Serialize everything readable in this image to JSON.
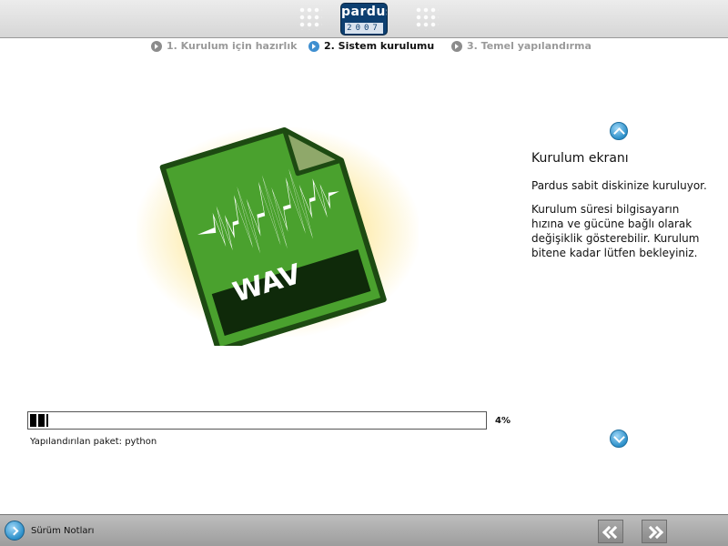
{
  "header": {
    "logo_text": "pardus",
    "logo_year": "2007"
  },
  "steps": [
    {
      "label": "1. Kurulum için hazırlık",
      "state": "done"
    },
    {
      "label": "2. Sistem kurulumu",
      "state": "active"
    },
    {
      "label": "3. Temel yapılandırma",
      "state": "pending"
    }
  ],
  "illustration": {
    "icon": "wav-file-icon",
    "label": "WAV",
    "colors": {
      "file": "#4aa12e",
      "border": "#1d4a12",
      "band": "#0f2a0a",
      "glow": "#fad65a"
    }
  },
  "panel": {
    "title": "Kurulum ekranı",
    "paragraph_1": "Pardus sabit diskinize kuruluyor.",
    "paragraph_2": "Kurulum süresi bilgisayarın hızına ve gücüne bağlı olarak değişiklik gösterebilir. Kurulum bitene kadar lütfen bekleyiniz."
  },
  "progress": {
    "value": 0.04,
    "percent_text": "4%",
    "status": "Yapılandırılan paket: python"
  },
  "footer": {
    "release_notes_label": "Sürüm Notları",
    "back_icon": "double-chevron-left-icon",
    "next_icon": "double-chevron-right-icon"
  }
}
